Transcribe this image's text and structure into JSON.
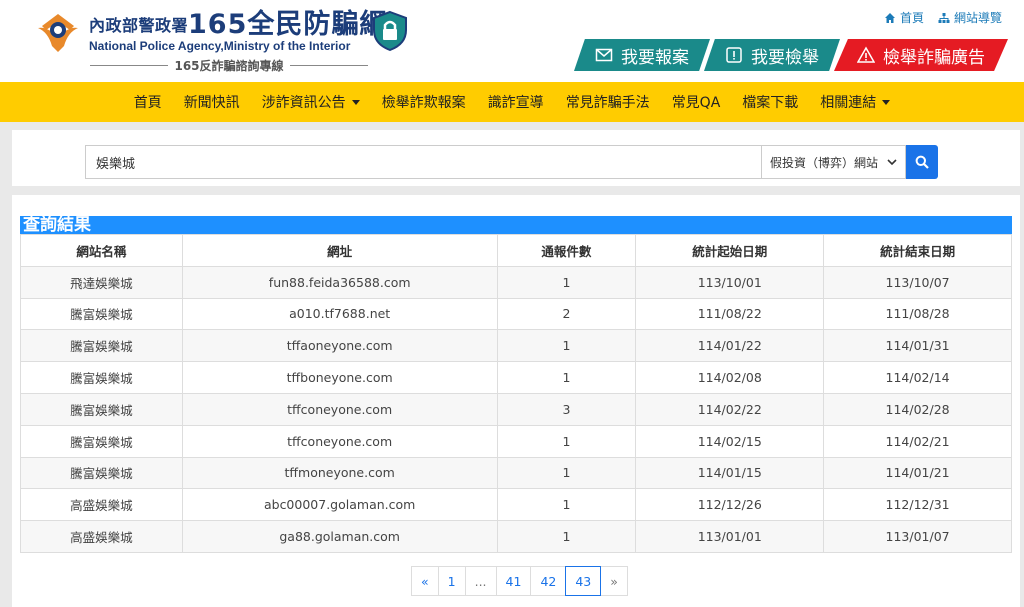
{
  "header": {
    "agency_cn": "內政部警政署",
    "brand": "165全民防騙網",
    "agency_en": "National Police Agency,Ministry of the Interior",
    "hotline": "165反詐騙諮詢專線",
    "top_links": [
      {
        "label": "首頁",
        "icon": "home-icon"
      },
      {
        "label": "網站導覽",
        "icon": "sitemap-icon"
      }
    ],
    "buttons": {
      "report": "我要報案",
      "tipoff": "我要檢舉",
      "ad": "檢舉詐騙廣告"
    },
    "colors": {
      "brand_blue": "#1c3d7a",
      "teal": "#1a8a8a",
      "red": "#e51b23"
    }
  },
  "nav": {
    "items": [
      "首頁",
      "新聞快訊",
      "涉詐資訊公告",
      "檢舉詐欺報案",
      "識詐宣導",
      "常見詐騙手法",
      "常見QA",
      "檔案下載",
      "相關連結"
    ],
    "color": "#ffcc00"
  },
  "search": {
    "value": "娛樂城",
    "category": "假投資（博弈）網站"
  },
  "results": {
    "title": "查詢結果",
    "columns": [
      "網站名稱",
      "網址",
      "通報件數",
      "統計起始日期",
      "統計結束日期"
    ],
    "rows": [
      [
        "飛達娛樂城",
        "fun88.feida36588.com",
        "1",
        "113/10/01",
        "113/10/07"
      ],
      [
        "騰富娛樂城",
        "a010.tf7688.net",
        "2",
        "111/08/22",
        "111/08/28"
      ],
      [
        "騰富娛樂城",
        "tffaoneyone.com",
        "1",
        "114/01/22",
        "114/01/31"
      ],
      [
        "騰富娛樂城",
        "tffboneyone.com",
        "1",
        "114/02/08",
        "114/02/14"
      ],
      [
        "騰富娛樂城",
        "tffconeyone.com",
        "3",
        "114/02/22",
        "114/02/28"
      ],
      [
        "騰富娛樂城",
        "tffconeyone.com",
        "1",
        "114/02/15",
        "114/02/21"
      ],
      [
        "騰富娛樂城",
        "tffmoneyone.com",
        "1",
        "114/01/15",
        "114/01/21"
      ],
      [
        "高盛娛樂城",
        "abc00007.golaman.com",
        "1",
        "112/12/26",
        "112/12/31"
      ],
      [
        "高盛娛樂城",
        "ga88.golaman.com",
        "1",
        "113/01/01",
        "113/01/07"
      ]
    ]
  },
  "pagination": {
    "prev": "«",
    "pages": [
      "1",
      "...",
      "41",
      "42",
      "43"
    ],
    "current": "43",
    "next": "»"
  }
}
